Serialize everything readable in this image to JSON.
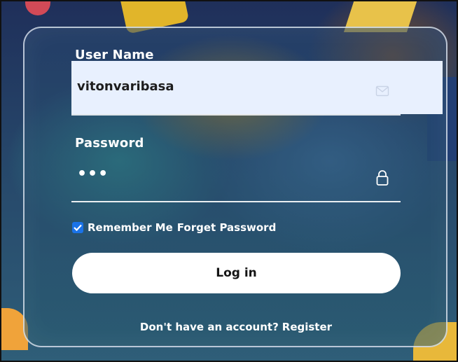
{
  "login_form": {
    "username": {
      "label": "User Name",
      "value": "vitonvaribasa",
      "icon": "mail-icon"
    },
    "password": {
      "label": "Password",
      "value": "•••",
      "icon": "lock-icon"
    },
    "remember_me": {
      "label": "Remember Me",
      "checked": true
    },
    "forget_password_label": "Forget Password",
    "login_button_label": "Log in",
    "register_prompt": "Don't have an account?",
    "register_link_label": "Register"
  },
  "colors": {
    "field_background": "#e8f0fe",
    "checkbox_accent": "#1a73e8",
    "button_background": "#ffffff"
  }
}
